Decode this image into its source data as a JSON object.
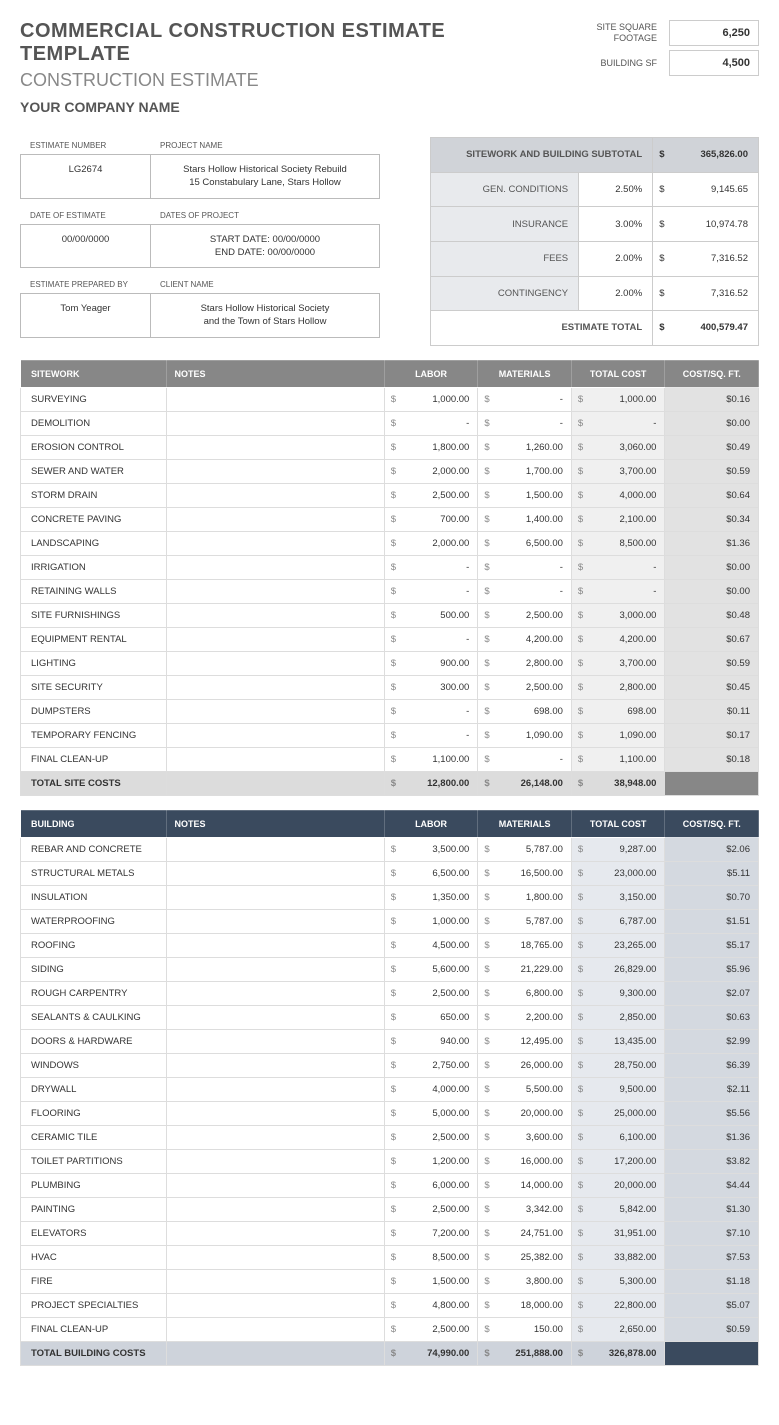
{
  "title": "COMMERCIAL CONSTRUCTION ESTIMATE TEMPLATE",
  "subtitle": "CONSTRUCTION ESTIMATE",
  "company": "YOUR COMPANY NAME",
  "metrics": {
    "site_sqft_label": "SITE SQUARE\nFOOTAGE",
    "site_sqft": "6,250",
    "building_sf_label": "BUILDING SF",
    "building_sf": "4,500"
  },
  "info": {
    "estimate_number_label": "ESTIMATE NUMBER",
    "estimate_number": "LG2674",
    "project_name_label": "PROJECT NAME",
    "project_name": "Stars Hollow Historical Society Rebuild\n15 Constabulary Lane, Stars Hollow",
    "date_of_estimate_label": "DATE OF ESTIMATE",
    "date_of_estimate": "00/00/0000",
    "dates_of_project_label": "DATES OF PROJECT",
    "dates_of_project": "START DATE: 00/00/0000\nEND DATE: 00/00/0000",
    "prepared_by_label": "ESTIMATE PREPARED BY",
    "prepared_by": "Tom Yeager",
    "client_name_label": "CLIENT NAME",
    "client_name": "Stars Hollow Historical Society\nand the Town of Stars Hollow"
  },
  "summary": {
    "subtotal_label": "SITEWORK AND BUILDING SUBTOTAL",
    "subtotal": "365,826.00",
    "rows": [
      {
        "label": "GEN. CONDITIONS",
        "pct": "2.50%",
        "amt": "9,145.65"
      },
      {
        "label": "INSURANCE",
        "pct": "3.00%",
        "amt": "10,974.78"
      },
      {
        "label": "FEES",
        "pct": "2.00%",
        "amt": "7,316.52"
      },
      {
        "label": "CONTINGENCY",
        "pct": "2.00%",
        "amt": "7,316.52"
      }
    ],
    "total_label": "ESTIMATE TOTAL",
    "total": "400,579.47"
  },
  "cols": {
    "c1_sw": "SITEWORK",
    "c1_bd": "BUILDING",
    "c2": "NOTES",
    "c3": "LABOR",
    "c4": "MATERIALS",
    "c5": "TOTAL COST",
    "c6": "COST/SQ. FT."
  },
  "sitework": {
    "rows": [
      {
        "name": "SURVEYING",
        "labor": "1,000.00",
        "materials": "-",
        "total": "1,000.00",
        "csf": "$0.16"
      },
      {
        "name": "DEMOLITION",
        "labor": "-",
        "materials": "-",
        "total": "-",
        "csf": "$0.00"
      },
      {
        "name": "EROSION CONTROL",
        "labor": "1,800.00",
        "materials": "1,260.00",
        "total": "3,060.00",
        "csf": "$0.49"
      },
      {
        "name": "SEWER AND WATER",
        "labor": "2,000.00",
        "materials": "1,700.00",
        "total": "3,700.00",
        "csf": "$0.59"
      },
      {
        "name": "STORM DRAIN",
        "labor": "2,500.00",
        "materials": "1,500.00",
        "total": "4,000.00",
        "csf": "$0.64"
      },
      {
        "name": "CONCRETE PAVING",
        "labor": "700.00",
        "materials": "1,400.00",
        "total": "2,100.00",
        "csf": "$0.34"
      },
      {
        "name": "LANDSCAPING",
        "labor": "2,000.00",
        "materials": "6,500.00",
        "total": "8,500.00",
        "csf": "$1.36"
      },
      {
        "name": "IRRIGATION",
        "labor": "-",
        "materials": "-",
        "total": "-",
        "csf": "$0.00"
      },
      {
        "name": "RETAINING WALLS",
        "labor": "-",
        "materials": "-",
        "total": "-",
        "csf": "$0.00"
      },
      {
        "name": "SITE FURNISHINGS",
        "labor": "500.00",
        "materials": "2,500.00",
        "total": "3,000.00",
        "csf": "$0.48"
      },
      {
        "name": "EQUIPMENT RENTAL",
        "labor": "-",
        "materials": "4,200.00",
        "total": "4,200.00",
        "csf": "$0.67"
      },
      {
        "name": "LIGHTING",
        "labor": "900.00",
        "materials": "2,800.00",
        "total": "3,700.00",
        "csf": "$0.59"
      },
      {
        "name": "SITE SECURITY",
        "labor": "300.00",
        "materials": "2,500.00",
        "total": "2,800.00",
        "csf": "$0.45"
      },
      {
        "name": "DUMPSTERS",
        "labor": "-",
        "materials": "698.00",
        "total": "698.00",
        "csf": "$0.11"
      },
      {
        "name": "TEMPORARY FENCING",
        "labor": "-",
        "materials": "1,090.00",
        "total": "1,090.00",
        "csf": "$0.17"
      },
      {
        "name": "FINAL CLEAN-UP",
        "labor": "1,100.00",
        "materials": "-",
        "total": "1,100.00",
        "csf": "$0.18"
      }
    ],
    "total": {
      "label": "TOTAL SITE COSTS",
      "labor": "12,800.00",
      "materials": "26,148.00",
      "total": "38,948.00"
    }
  },
  "building": {
    "rows": [
      {
        "name": "REBAR AND CONCRETE",
        "labor": "3,500.00",
        "materials": "5,787.00",
        "total": "9,287.00",
        "csf": "$2.06"
      },
      {
        "name": "STRUCTURAL METALS",
        "labor": "6,500.00",
        "materials": "16,500.00",
        "total": "23,000.00",
        "csf": "$5.11"
      },
      {
        "name": "INSULATION",
        "labor": "1,350.00",
        "materials": "1,800.00",
        "total": "3,150.00",
        "csf": "$0.70"
      },
      {
        "name": "WATERPROOFING",
        "labor": "1,000.00",
        "materials": "5,787.00",
        "total": "6,787.00",
        "csf": "$1.51"
      },
      {
        "name": "ROOFING",
        "labor": "4,500.00",
        "materials": "18,765.00",
        "total": "23,265.00",
        "csf": "$5.17"
      },
      {
        "name": "SIDING",
        "labor": "5,600.00",
        "materials": "21,229.00",
        "total": "26,829.00",
        "csf": "$5.96"
      },
      {
        "name": "ROUGH CARPENTRY",
        "labor": "2,500.00",
        "materials": "6,800.00",
        "total": "9,300.00",
        "csf": "$2.07"
      },
      {
        "name": "SEALANTS & CAULKING",
        "labor": "650.00",
        "materials": "2,200.00",
        "total": "2,850.00",
        "csf": "$0.63"
      },
      {
        "name": "DOORS & HARDWARE",
        "labor": "940.00",
        "materials": "12,495.00",
        "total": "13,435.00",
        "csf": "$2.99"
      },
      {
        "name": "WINDOWS",
        "labor": "2,750.00",
        "materials": "26,000.00",
        "total": "28,750.00",
        "csf": "$6.39"
      },
      {
        "name": "DRYWALL",
        "labor": "4,000.00",
        "materials": "5,500.00",
        "total": "9,500.00",
        "csf": "$2.11"
      },
      {
        "name": "FLOORING",
        "labor": "5,000.00",
        "materials": "20,000.00",
        "total": "25,000.00",
        "csf": "$5.56"
      },
      {
        "name": "CERAMIC TILE",
        "labor": "2,500.00",
        "materials": "3,600.00",
        "total": "6,100.00",
        "csf": "$1.36"
      },
      {
        "name": "TOILET PARTITIONS",
        "labor": "1,200.00",
        "materials": "16,000.00",
        "total": "17,200.00",
        "csf": "$3.82"
      },
      {
        "name": "PLUMBING",
        "labor": "6,000.00",
        "materials": "14,000.00",
        "total": "20,000.00",
        "csf": "$4.44"
      },
      {
        "name": "PAINTING",
        "labor": "2,500.00",
        "materials": "3,342.00",
        "total": "5,842.00",
        "csf": "$1.30"
      },
      {
        "name": "ELEVATORS",
        "labor": "7,200.00",
        "materials": "24,751.00",
        "total": "31,951.00",
        "csf": "$7.10"
      },
      {
        "name": "HVAC",
        "labor": "8,500.00",
        "materials": "25,382.00",
        "total": "33,882.00",
        "csf": "$7.53"
      },
      {
        "name": "FIRE",
        "labor": "1,500.00",
        "materials": "3,800.00",
        "total": "5,300.00",
        "csf": "$1.18"
      },
      {
        "name": "PROJECT SPECIALTIES",
        "labor": "4,800.00",
        "materials": "18,000.00",
        "total": "22,800.00",
        "csf": "$5.07"
      },
      {
        "name": "FINAL CLEAN-UP",
        "labor": "2,500.00",
        "materials": "150.00",
        "total": "2,650.00",
        "csf": "$0.59"
      }
    ],
    "total": {
      "label": "TOTAL BUILDING COSTS",
      "labor": "74,990.00",
      "materials": "251,888.00",
      "total": "326,878.00"
    }
  }
}
